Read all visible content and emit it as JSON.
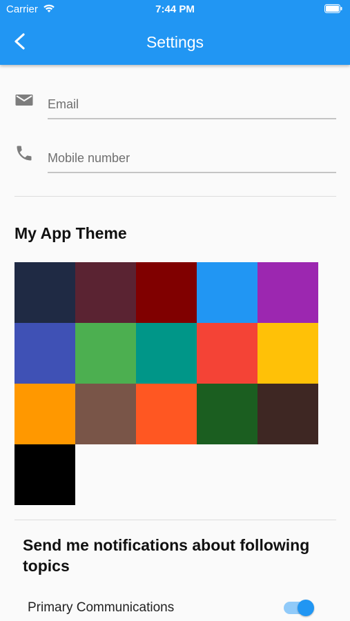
{
  "status_bar": {
    "carrier": "Carrier",
    "time": "7:44 PM"
  },
  "app_bar": {
    "title": "Settings",
    "back_icon": "chevron-left-icon",
    "color": "#2196f3"
  },
  "form": {
    "email": {
      "icon": "mail-icon",
      "placeholder": "Email",
      "value": ""
    },
    "mobile": {
      "icon": "phone-icon",
      "placeholder": "Mobile number",
      "value": ""
    }
  },
  "theme": {
    "title": "My App Theme",
    "colors": [
      "#1f2a44",
      "#5a2332",
      "#800000",
      "#2196f3",
      "#9c27b0",
      "#3f51b5",
      "#4caf50",
      "#009688",
      "#f44336",
      "#ffc107",
      "#ff9800",
      "#795548",
      "#ff5722",
      "#1b5e20",
      "#3e2723",
      "#000000"
    ]
  },
  "notifications": {
    "title": "Send me notifications about following topics",
    "topics": [
      {
        "label": "Primary Communications",
        "enabled": true
      }
    ]
  }
}
